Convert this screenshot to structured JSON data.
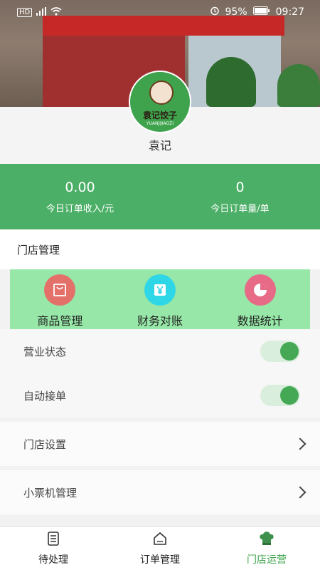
{
  "status_bar": {
    "left_indicators": "HD",
    "battery": "95%",
    "time": "09:27"
  },
  "store": {
    "logo_text": "袁记饺子",
    "logo_text_en": "YUANJIJIAOZI",
    "name": "袁记"
  },
  "stats": [
    {
      "value": "0.00",
      "label": "今日订单收入/元"
    },
    {
      "value": "0",
      "label": "今日订单量/单"
    }
  ],
  "section": {
    "title": "门店管理"
  },
  "actions": [
    {
      "label": "商品管理",
      "icon": "bag-icon",
      "color": "#e4706a"
    },
    {
      "label": "财务对账",
      "icon": "yen-icon",
      "color": "#2fd6e6"
    },
    {
      "label": "数据统计",
      "icon": "pie-chart-icon",
      "color": "#e76a86"
    }
  ],
  "toggles": [
    {
      "label": "营业状态",
      "on": true
    },
    {
      "label": "自动接单",
      "on": true
    }
  ],
  "nav_rows": [
    {
      "label": "门店设置"
    },
    {
      "label": "小票机管理"
    }
  ],
  "tabs": [
    {
      "label": "待处理",
      "icon": "clipboard-icon",
      "active": false
    },
    {
      "label": "订单管理",
      "icon": "order-house-icon",
      "active": false
    },
    {
      "label": "门店运营",
      "icon": "chef-hat-icon",
      "active": true
    }
  ],
  "colors": {
    "accent": "#4caf67",
    "action_bg": "#97e8a8"
  }
}
